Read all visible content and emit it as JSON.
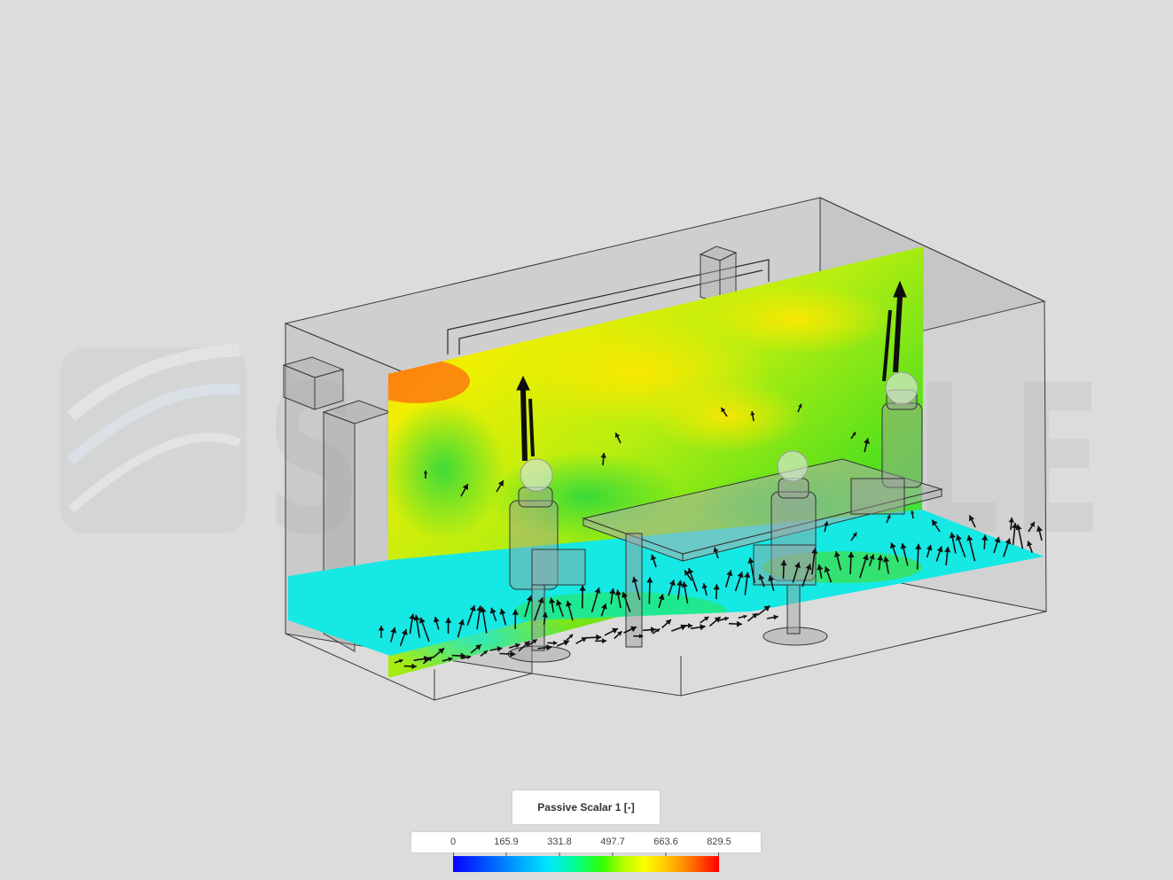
{
  "legend": {
    "title": "Passive Scalar 1 [-]",
    "min": 0,
    "max": 829.5,
    "ticks": [
      "0",
      "165.9",
      "331.8",
      "497.7",
      "663.6",
      "829.5"
    ]
  },
  "colors": {
    "background": "#dcdcdc",
    "geometry_outline": "#3a3a3a",
    "arrow": "#111111"
  },
  "watermark": {
    "text": "SIMSCALE"
  }
}
